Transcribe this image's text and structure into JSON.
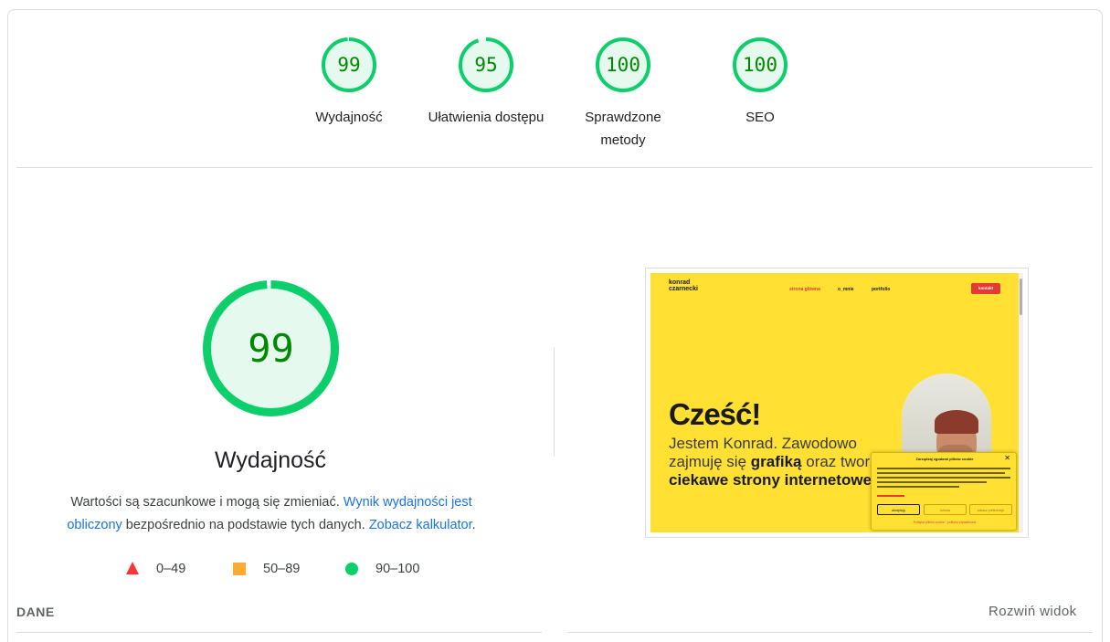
{
  "summary": {
    "gauges": [
      {
        "score": "99",
        "label": "Wydajność",
        "label2": ""
      },
      {
        "score": "95",
        "label": "Ułatwienia dostępu",
        "label2": ""
      },
      {
        "score": "100",
        "label": "Sprawdzone",
        "label2": "metody"
      },
      {
        "score": "100",
        "label": "SEO",
        "label2": ""
      }
    ]
  },
  "main": {
    "score": "99",
    "title": "Wydajność",
    "desc_prefix": "Wartości są szacunkowe i mogą się zmieniać. ",
    "desc_link1": "Wynik wydajności jest obliczony",
    "desc_middle": " bezpośrednio na podstawie tych danych. ",
    "desc_link2": "Zobacz kalkulator",
    "desc_suffix": "."
  },
  "legend": {
    "fail": "0–49",
    "average": "50–89",
    "pass": "90–100"
  },
  "colors": {
    "pass": "#0cce6b",
    "pass_bg": "#e6f9ee",
    "pass_text": "#008800",
    "average": "#ffaa33",
    "fail": "#ff3333",
    "link": "#1a73e8"
  },
  "screenshot": {
    "logo_line1": "konrad",
    "logo_line2": "czarnecki",
    "nav": [
      "strona główna",
      "o_mnie",
      "portfolio"
    ],
    "cta": "kontakt",
    "heading": "Cześć!",
    "intro_1": "Jestem Konrad. Zawodowo zajmuję się ",
    "intro_b1": "grafiką",
    "intro_2": " oraz tworzę ",
    "intro_b2": "ciekawe strony internetowe.",
    "cookie_title": "Zarządzaj zgodami plików cookie",
    "cookie_close": "✕",
    "cookie_buttons": [
      "akceptuję",
      "odmów",
      "zobacz preferencje"
    ],
    "cookie_footer": "Polityka plików cookie · polityka prywatności"
  },
  "footer": {
    "section_label": "DANE",
    "expand_label": "Rozwiń widok"
  }
}
